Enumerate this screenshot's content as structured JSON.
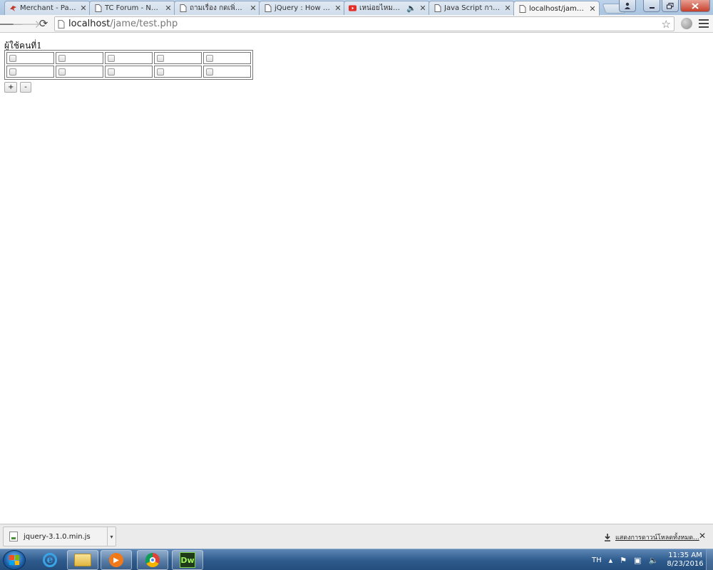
{
  "browser": {
    "tabs": [
      {
        "label": "Merchant - Page 2",
        "icon": "bird-favicon-icon",
        "active": false
      },
      {
        "label": "TC Forum - New Topic",
        "icon": "page-icon",
        "active": false
      },
      {
        "label": "ถามเรื่อง กดเพิ่ม input",
        "icon": "page-icon",
        "active": false
      },
      {
        "label": "jQuery : How to use",
        "icon": "page-icon",
        "active": false
      },
      {
        "label": "เหน่อยไหมหัวใจ",
        "icon": "youtube-icon",
        "active": false
      },
      {
        "label": "Java Script การเพิ่ม",
        "icon": "page-icon",
        "active": false
      },
      {
        "label": "localhost/jame/test",
        "icon": "page-icon",
        "active": true
      }
    ],
    "address": {
      "host": "localhost",
      "path": "/jame/test.php"
    }
  },
  "page": {
    "user_label": "ผู้ใช้คนที่1",
    "grid": {
      "rows": 2,
      "cols": 5
    },
    "add_button": "+",
    "remove_button": "-"
  },
  "downloads": {
    "file_name": "jquery-3.1.0.min.js",
    "show_all": "แสดงการดาวน์โหลดทั้งหมด..."
  },
  "taskbar": {
    "lang": "TH",
    "time": "11:35 AM",
    "date": "8/23/2016"
  }
}
